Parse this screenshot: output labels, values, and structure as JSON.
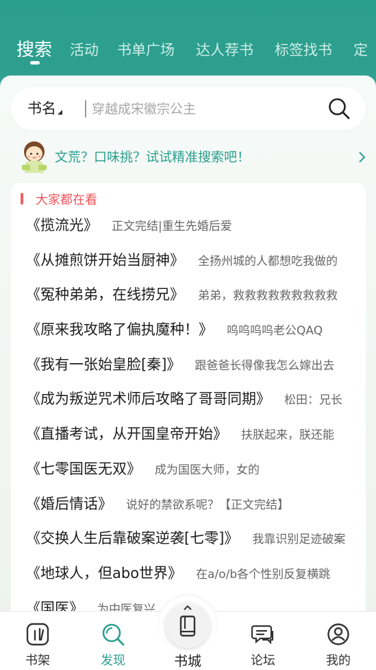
{
  "colors": {
    "brand": "#2b9f8e",
    "section_accent": "#f0545a"
  },
  "tabs": [
    {
      "label": "搜索",
      "active": true
    },
    {
      "label": "活动",
      "active": false
    },
    {
      "label": "书单广场",
      "active": false
    },
    {
      "label": "达人荐书",
      "active": false
    },
    {
      "label": "标签找书",
      "active": false
    },
    {
      "label": "定",
      "active": false
    }
  ],
  "search": {
    "type_label": "书名",
    "placeholder": "穿越成宋徽宗公主",
    "icon": "search-icon"
  },
  "promo": {
    "text": "文荒？口味挑？试试精准搜索吧！",
    "icon": "mascot-icon"
  },
  "popular": {
    "title": "大家都在看",
    "books": [
      {
        "title": "《揽流光》",
        "desc": "正文完结|重生先婚后爱"
      },
      {
        "title": "《从摊煎饼开始当厨神》",
        "desc": "全扬州城的人都想吃我做的"
      },
      {
        "title": "《冤种弟弟，在线捞兄》",
        "desc": "弟弟，救救救救救救救救救"
      },
      {
        "title": "《原来我攻略了偏执魔种！》",
        "desc": "呜呜呜呜老公QAQ"
      },
      {
        "title": "《我有一张始皇脸[秦]》",
        "desc": "跟爸爸长得像我怎么嫁出去"
      },
      {
        "title": "《成为叛逆咒术师后攻略了哥哥同期》",
        "desc": "松田：兄长"
      },
      {
        "title": "《直播考试，从开国皇帝开始》",
        "desc": "扶朕起来，朕还能"
      },
      {
        "title": "《七零国医无双》",
        "desc": "成为国医大师，女的"
      },
      {
        "title": "《婚后情话》",
        "desc": "说好的禁欲系呢？【正文完结】"
      },
      {
        "title": "《交换人生后靠破案逆袭[七零]》",
        "desc": "我靠识别足迹破案"
      },
      {
        "title": "《地球人，但abo世界》",
        "desc": "在a/o/b各个性别反复横跳"
      },
      {
        "title": "《国医》",
        "desc": "为中医复兴"
      }
    ]
  },
  "nav": {
    "items": [
      {
        "label": "书架",
        "icon": "bookshelf-icon",
        "active": false
      },
      {
        "label": "发现",
        "icon": "discover-search-icon",
        "active": true
      },
      {
        "label": "书城",
        "icon": "book-city-icon",
        "active": false
      },
      {
        "label": "论坛",
        "icon": "forum-chat-icon",
        "active": false
      },
      {
        "label": "我的",
        "icon": "profile-icon",
        "active": false
      }
    ]
  }
}
